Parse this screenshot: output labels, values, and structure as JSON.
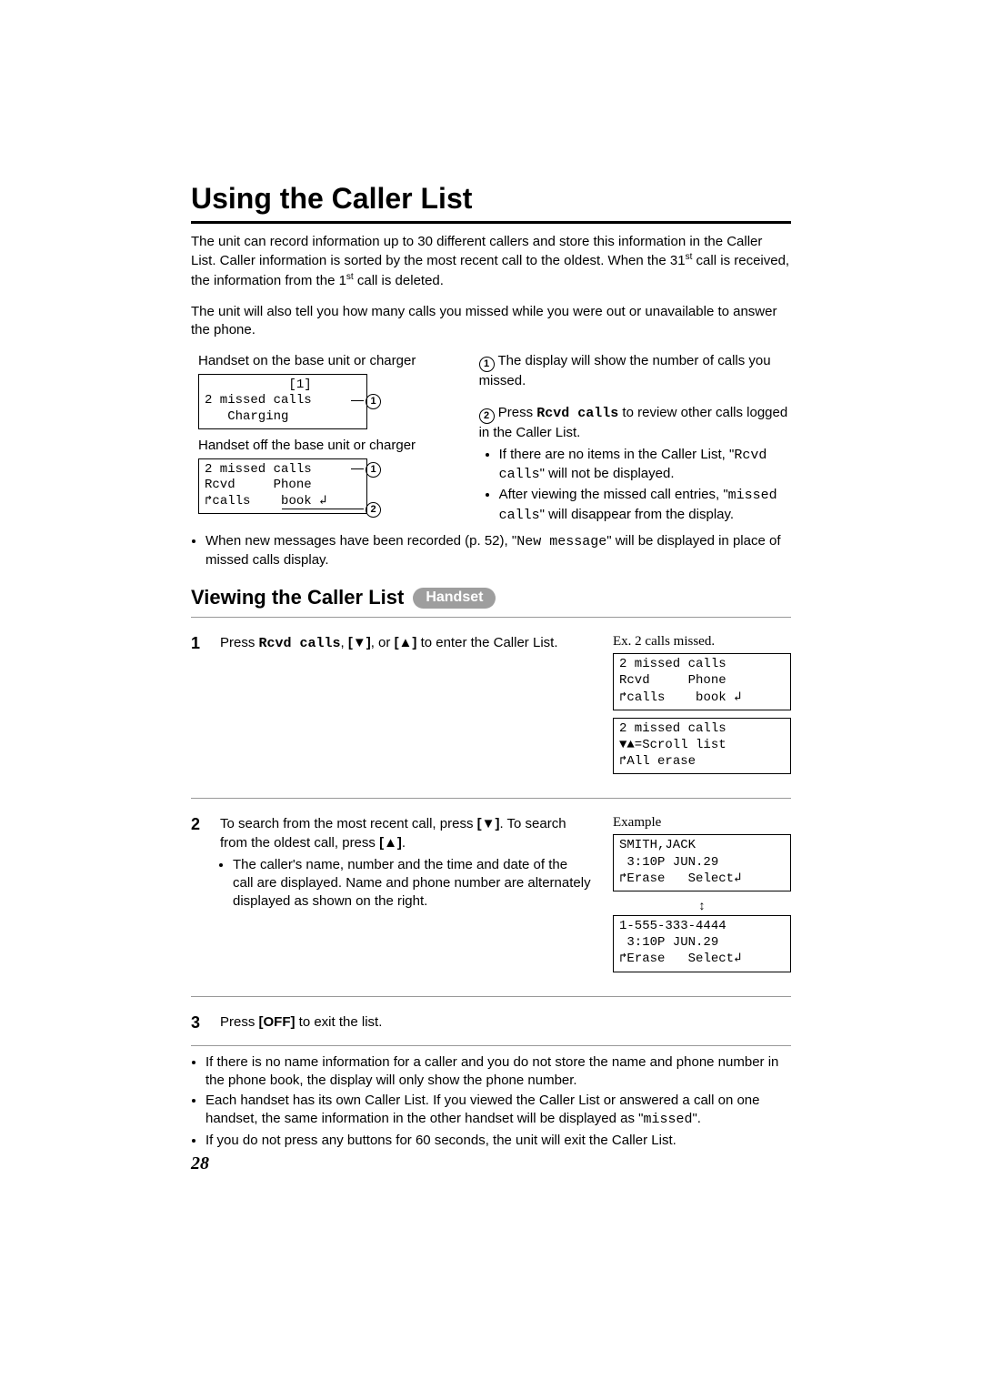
{
  "title": "Using the Caller List",
  "intro1_a": "The unit can record information up to 30 different callers and store this information in the Caller List. Caller information is sorted by the most recent call to the oldest. When the 31",
  "intro1_b": " call is received, the information from the 1",
  "intro1_c": " call is deleted.",
  "sup_st": "st",
  "intro2": "The unit will also tell you how many calls you missed while you were out or unavailable to answer the phone.",
  "left": {
    "label_on": "Handset on the base unit or charger",
    "lcd_on": "           [1]\n2 missed calls\n   Charging",
    "label_off": "Handset off the base unit or charger",
    "lcd_off": "2 missed calls\nRcvd     Phone\n↱calls    book ↲"
  },
  "right": {
    "c1_text": " The display will show the number of calls you missed.",
    "c2_a": " Press ",
    "c2_cmd": "Rcvd calls",
    "c2_b": " to review other calls logged in the Caller List.",
    "bul1_a": "If there are no items in the Caller List, \"",
    "bul1_cmd": "Rcvd calls",
    "bul1_b": "\" will not be displayed.",
    "bul2_a": "After viewing the missed call entries, \"",
    "bul2_cmd": "missed calls",
    "bul2_b": "\" will disappear from the display."
  },
  "mid_a": "When new messages have been recorded (p. 52), \"",
  "mid_cmd": "New message",
  "mid_b": "\" will be displayed in place of missed calls display.",
  "h2": "Viewing the Caller List",
  "pill": "Handset",
  "step1": {
    "a": "Press ",
    "cmd": "Rcvd calls",
    "b": ", ",
    "down": "[▼]",
    "c": ", or ",
    "up": "[▲]",
    "d": " to enter the Caller List.",
    "side_title": "Ex. 2 calls missed.",
    "lcd1": "2 missed calls\nRcvd     Phone\n↱calls    book ↲",
    "lcd2": "2 missed calls\n▼▲=Scroll list\n↱All erase"
  },
  "step2": {
    "a": "To search from the most recent call, press ",
    "down": "[▼]",
    "b": ". To search from the oldest call, press ",
    "up": "[▲]",
    "c": ".",
    "bul": "The caller's name, number and the time and date of the call are displayed. Name and phone number are alternately displayed as shown on the right.",
    "side_title": "Example",
    "lcd1": "SMITH,JACK\n 3:10P JUN.29\n↱Erase   Select↲",
    "lcd2": "1-555-333-4444\n 3:10P JUN.29\n↱Erase   Select↲"
  },
  "step3": {
    "a": "Press ",
    "off": "[OFF]",
    "b": " to exit the list."
  },
  "notes": {
    "n1": "If there is no name information for a caller and you do not store the name and phone number in the phone book, the display will only show the phone number.",
    "n2_a": "Each handset has its own Caller List. If you viewed the Caller List or answered a call on one handset, the same information in the other handset will be displayed as \"",
    "n2_cmd": "missed",
    "n2_b": "\".",
    "n3": "If you do not press any buttons for 60 seconds, the unit will exit the Caller List."
  },
  "page_no": "28"
}
